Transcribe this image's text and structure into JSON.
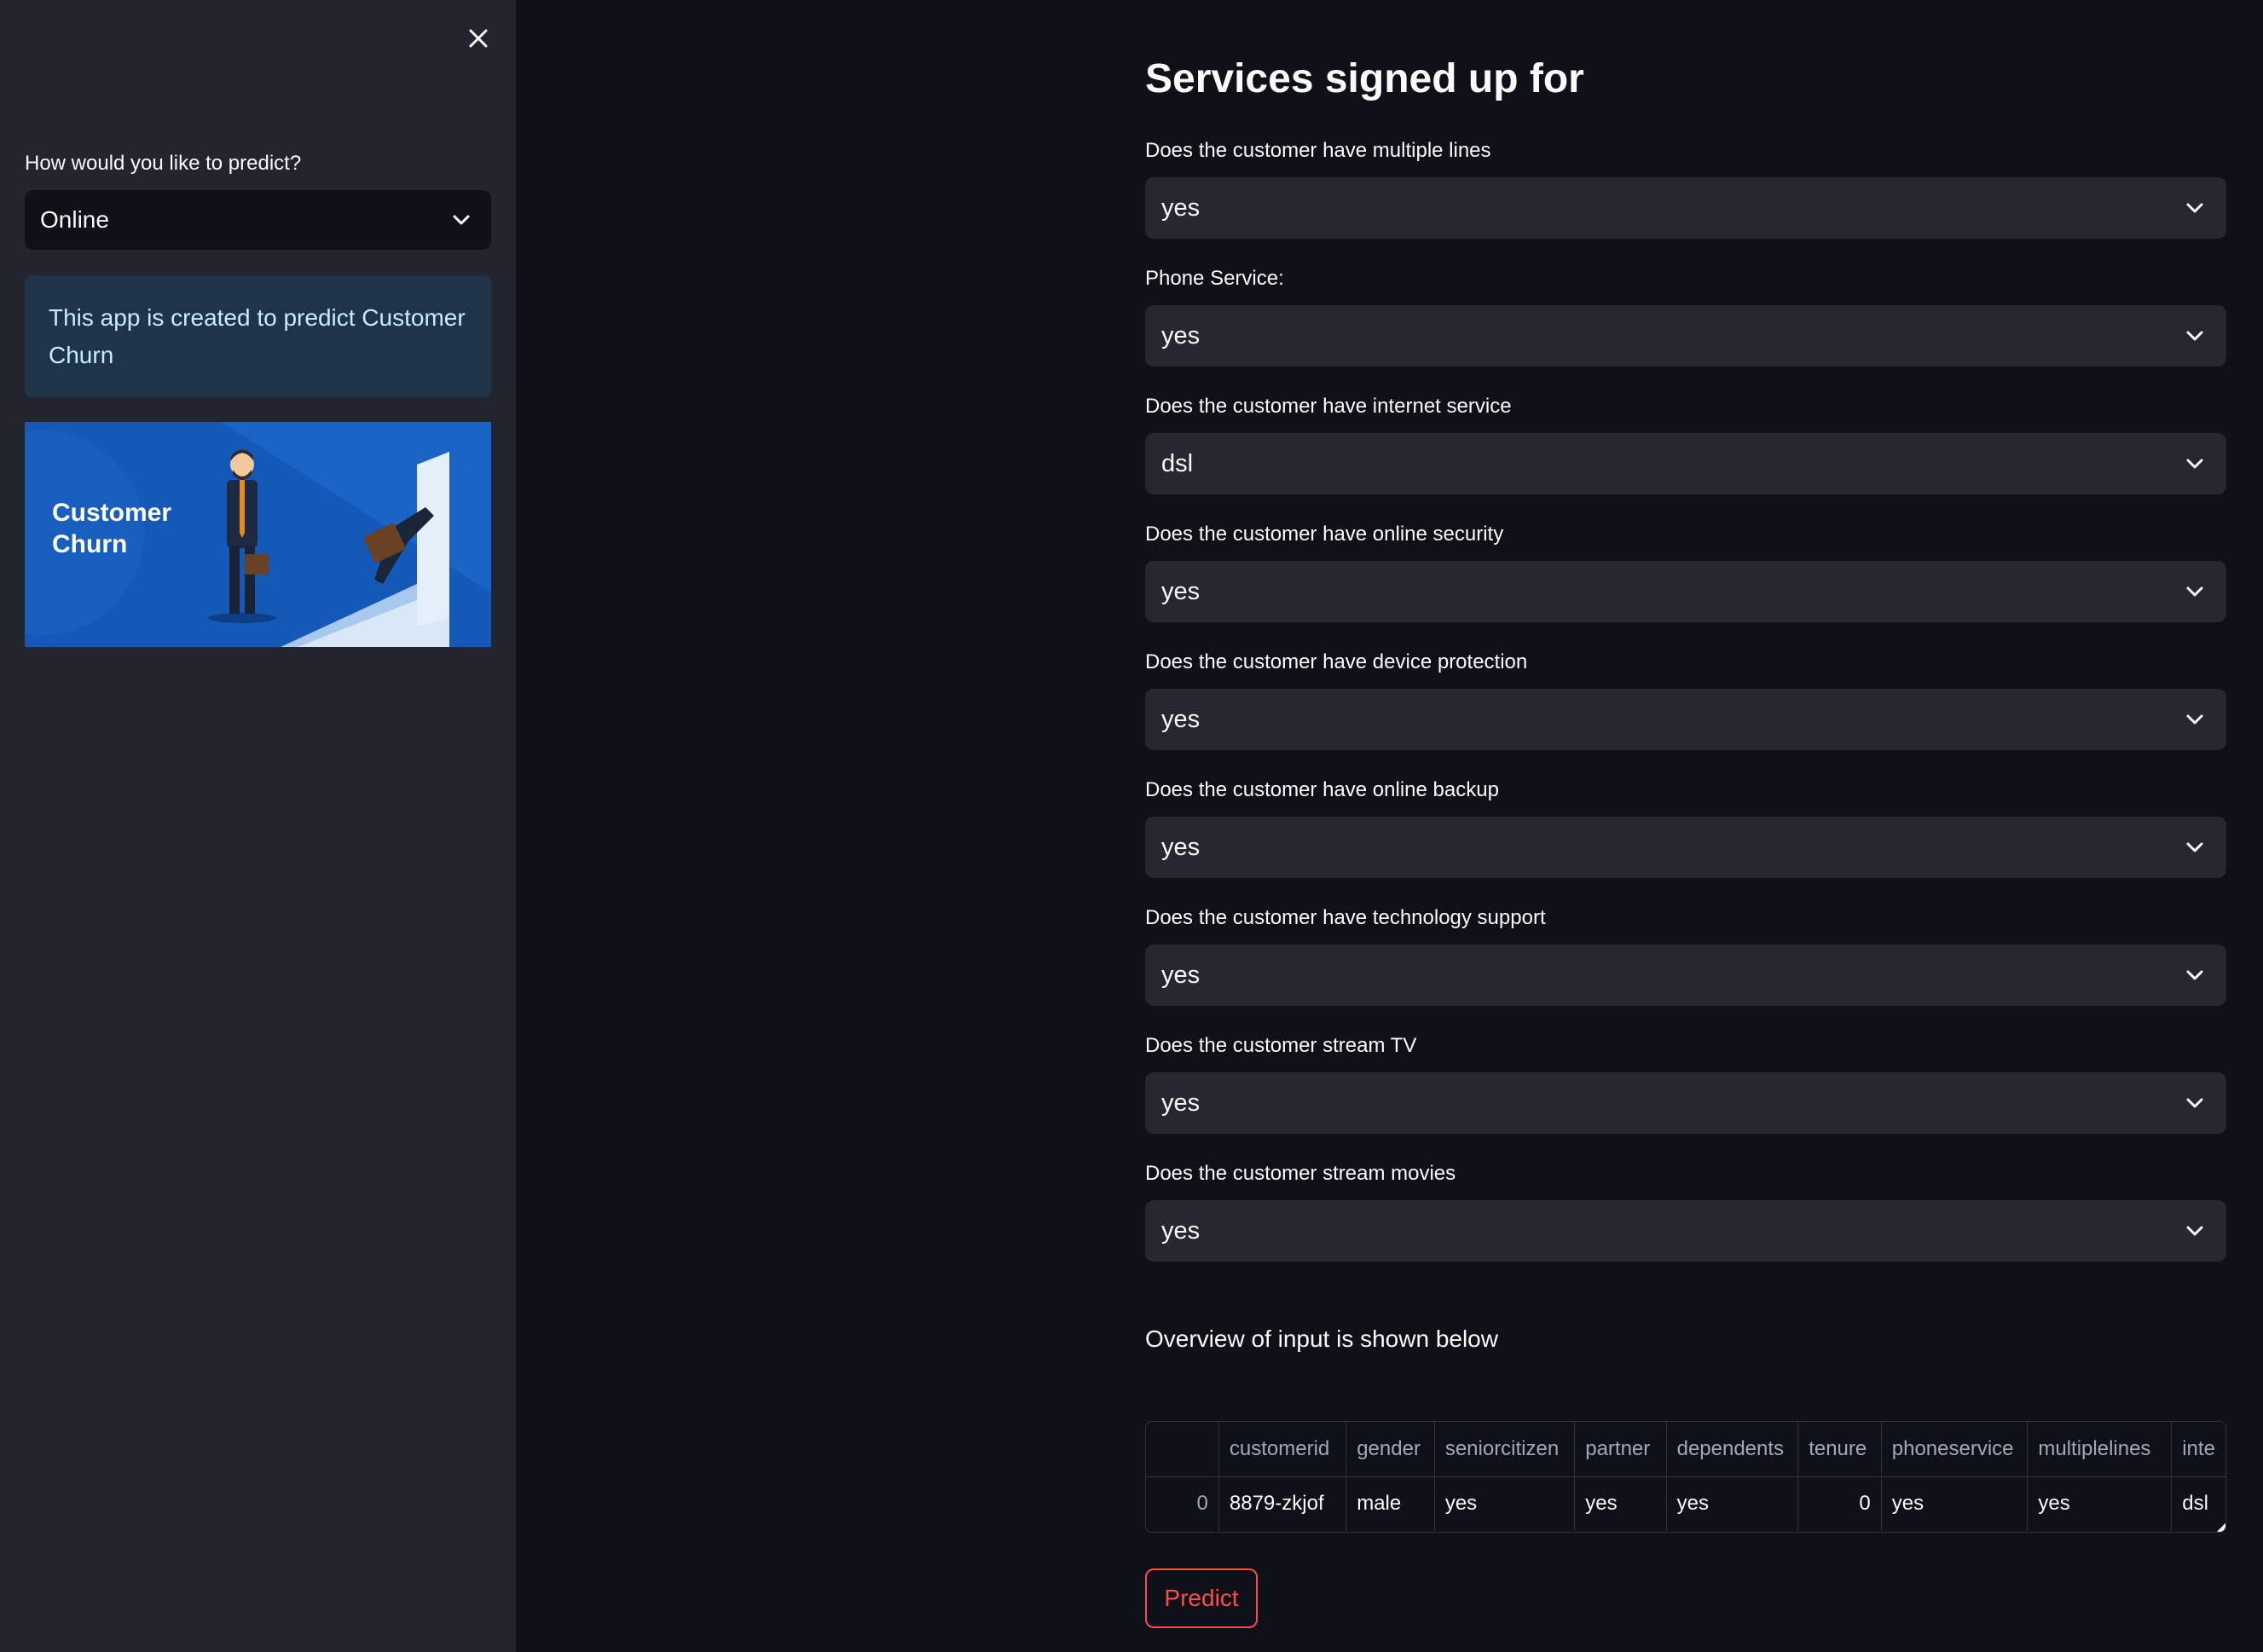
{
  "sidebar": {
    "predict_label": "How would you like to predict?",
    "predict_value": "Online",
    "info_text": "This app is created to predict Customer Churn",
    "banner_text": "Customer Churn"
  },
  "main": {
    "title": "Services signed up for",
    "fields": [
      {
        "label": "Does the customer have multiple lines",
        "value": "yes"
      },
      {
        "label": "Phone Service:",
        "value": "yes"
      },
      {
        "label": "Does the customer have internet service",
        "value": "dsl"
      },
      {
        "label": "Does the customer have online security",
        "value": "yes"
      },
      {
        "label": "Does the customer have device protection",
        "value": "yes"
      },
      {
        "label": "Does the customer have online backup",
        "value": "yes"
      },
      {
        "label": "Does the customer have technology support",
        "value": "yes"
      },
      {
        "label": "Does the customer stream TV",
        "value": "yes"
      },
      {
        "label": "Does the customer stream movies",
        "value": "yes"
      }
    ],
    "overview_text": "Overview of input is shown below",
    "table": {
      "headers": [
        "",
        "customerid",
        "gender",
        "seniorcitizen",
        "partner",
        "dependents",
        "tenure",
        "phoneservice",
        "multiplelines",
        "inte"
      ],
      "row": [
        "0",
        "8879-zkjof",
        "male",
        "yes",
        "yes",
        "yes",
        "0",
        "yes",
        "yes",
        "dsl"
      ]
    },
    "predict_label": "Predict"
  }
}
